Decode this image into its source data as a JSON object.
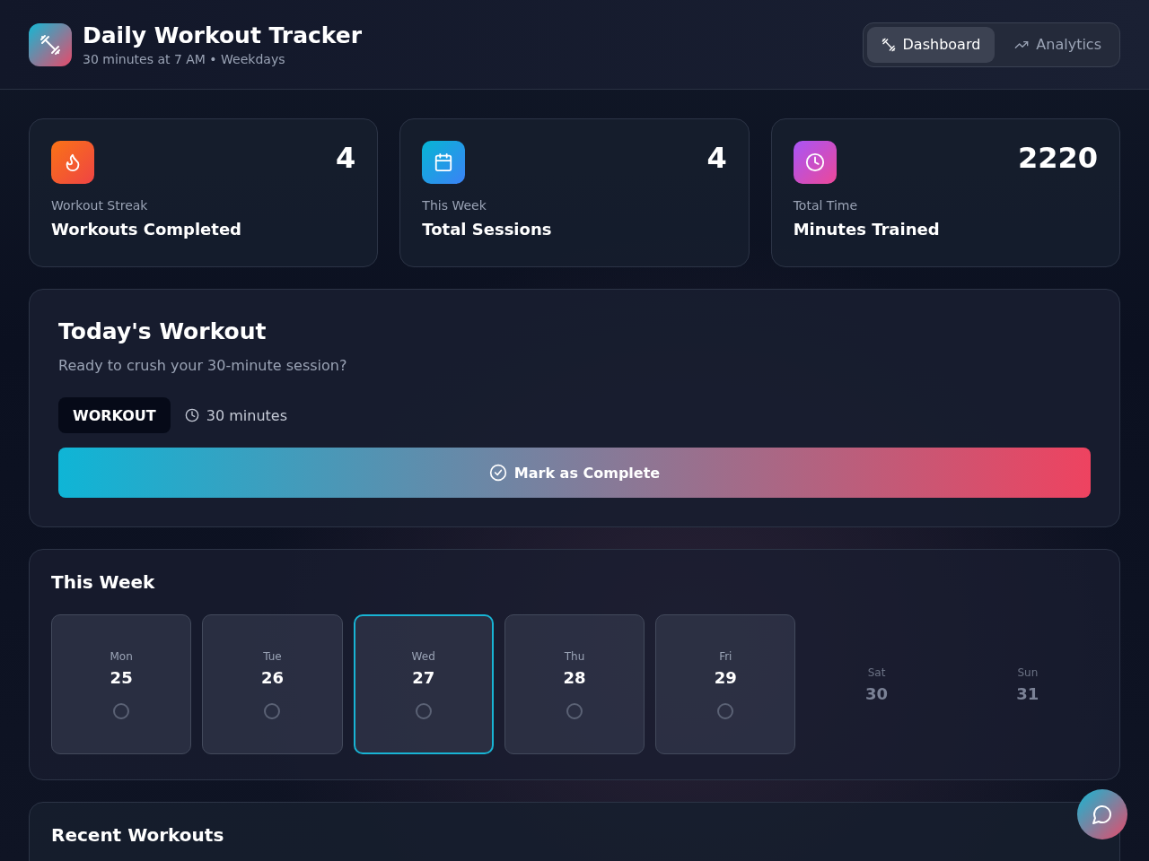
{
  "header": {
    "title": "Daily Workout Tracker",
    "subtitle": "30 minutes at 7 AM • Weekdays"
  },
  "nav": [
    {
      "label": "Dashboard",
      "kind": "dumbbell",
      "selected": true
    },
    {
      "label": "Analytics",
      "kind": "trend",
      "selected": false
    }
  ],
  "stats": [
    {
      "kind": "flame",
      "value": "4",
      "caption": "Workout Streak",
      "label": "Workouts Completed"
    },
    {
      "kind": "calendar",
      "value": "4",
      "caption": "This Week",
      "label": "Total Sessions"
    },
    {
      "kind": "clock",
      "value": "2220",
      "caption": "Total Time",
      "label": "Minutes Trained"
    }
  ],
  "today": {
    "title": "Today's Workout",
    "subtitle": "Ready to crush your 30-minute session?",
    "badge": "WORKOUT",
    "duration": "30 minutes",
    "button": "Mark as Complete"
  },
  "week": {
    "title": "This Week",
    "days": [
      {
        "kind": "workday",
        "day": "Mon",
        "date": "25",
        "selected": false,
        "completed": false
      },
      {
        "kind": "workday",
        "day": "Tue",
        "date": "26",
        "selected": false,
        "completed": false
      },
      {
        "kind": "workday",
        "day": "Wed",
        "date": "27",
        "selected": true,
        "completed": false
      },
      {
        "kind": "workday",
        "day": "Thu",
        "date": "28",
        "selected": false,
        "completed": false
      },
      {
        "kind": "workday",
        "day": "Fri",
        "date": "29",
        "selected": false,
        "completed": false
      },
      {
        "kind": "rest",
        "day": "Sat",
        "date": "30",
        "selected": false
      },
      {
        "kind": "rest",
        "day": "Sun",
        "date": "31",
        "selected": false
      }
    ]
  },
  "recent": {
    "title": "Recent Workouts"
  }
}
